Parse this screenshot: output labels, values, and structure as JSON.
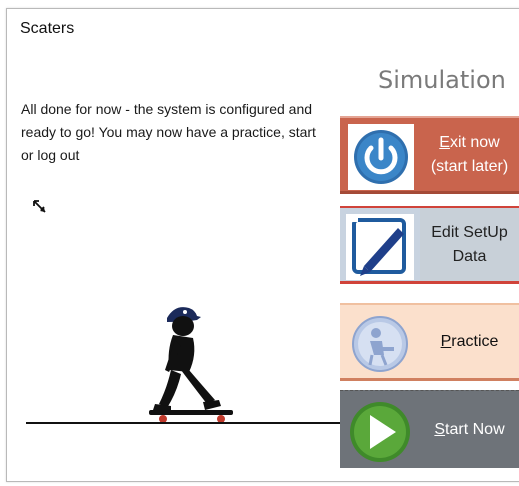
{
  "window": {
    "title": "Scaters"
  },
  "heading": "Simulation",
  "message": "All done for now - the system is configured and ready to go! You may now have a practice, start or log out",
  "buttons": {
    "exit": {
      "mnemonic": "E",
      "rest": "xit now",
      "line2": "(start later)",
      "icon": "power-icon",
      "color": "#c9644d"
    },
    "edit": {
      "line1": "Edit SetUp",
      "line2": "Data",
      "icon": "pen-icon"
    },
    "practice": {
      "mnemonic": "P",
      "rest": "ractice",
      "icon": "practice-figure-icon",
      "color": "#fbe0cc"
    },
    "start": {
      "mnemonic": "S",
      "rest": "tart Now",
      "icon": "play-icon",
      "color": "#6e7379"
    }
  },
  "illustration": "skateboarder-icon"
}
